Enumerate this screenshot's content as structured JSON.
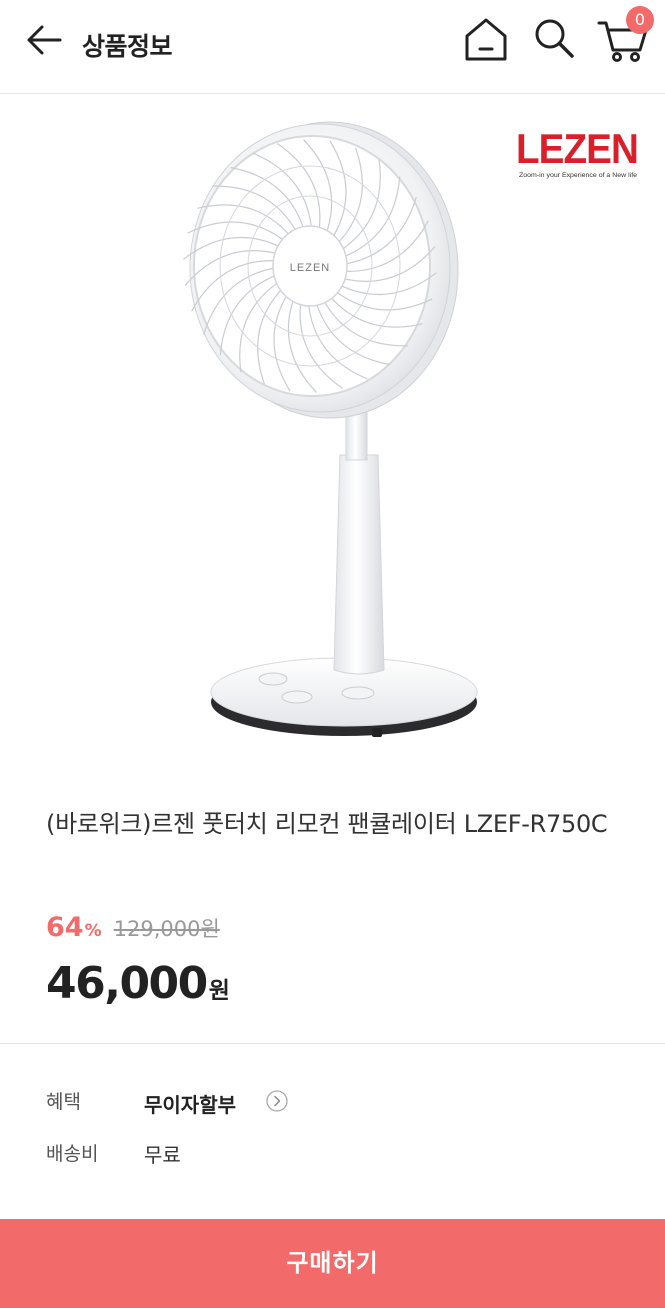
{
  "header": {
    "title": "상품정보",
    "back_icon": "arrow-left-icon",
    "home_icon": "home-icon",
    "search_icon": "search-icon",
    "cart_icon": "cart-icon",
    "cart_count": "0"
  },
  "product": {
    "brand_logo_text": "LEZEN",
    "brand_tagline": "Zoom-in your Experience of a New life",
    "fan_center_logo": "LEZEN",
    "name": "(바로위크)르젠 풋터치 리모컨 팬큘레이터 LZEF-R750C",
    "discount_rate": "64",
    "discount_unit": "%",
    "original_price": "129,000원",
    "sale_price": "46,000",
    "sale_unit": "원"
  },
  "info": {
    "benefit_label": "혜택",
    "benefit_value": "무이자할부",
    "shipping_label": "배송비",
    "shipping_value": "무료"
  },
  "buy_button": {
    "label": "구매하기"
  },
  "colors": {
    "accent": "#f36a6a",
    "logo_red": "#d8202a",
    "text": "#222222"
  }
}
